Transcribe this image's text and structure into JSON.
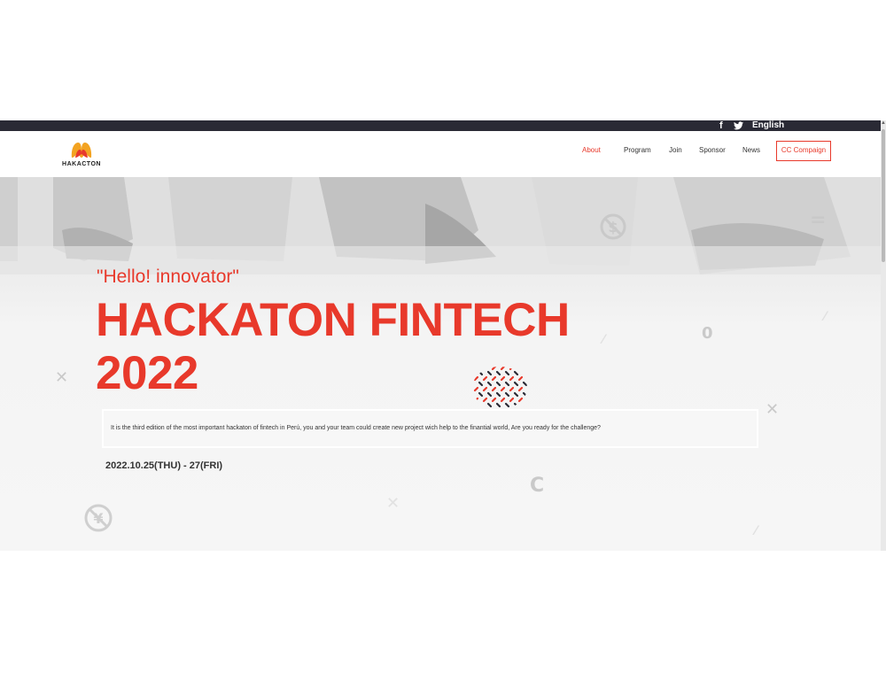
{
  "topbar": {
    "facebook_icon": "facebook-icon",
    "twitter_icon": "twitter-icon",
    "language": "English"
  },
  "header": {
    "logo_text": "HAKACTON",
    "nav": {
      "about": "About",
      "program": "Program",
      "join": "Join",
      "sponsor": "Sponsor",
      "news": "News",
      "cc_campaign": "CC Compaign"
    }
  },
  "hero": {
    "greeting": "\"Hello! innovator\"",
    "title_line1": "HACKATON FINTECH",
    "title_line2": "2022",
    "description": "It is the third edition of the most important hackaton of fintech in Perú, you and your team could create new project wich help to the finantial world, Are you ready for the challenge?",
    "date": "2022.10.25(THU) - 27(FRI)"
  },
  "colors": {
    "accent": "#e8392b",
    "topbar": "#2a2a35",
    "text": "#333333"
  }
}
